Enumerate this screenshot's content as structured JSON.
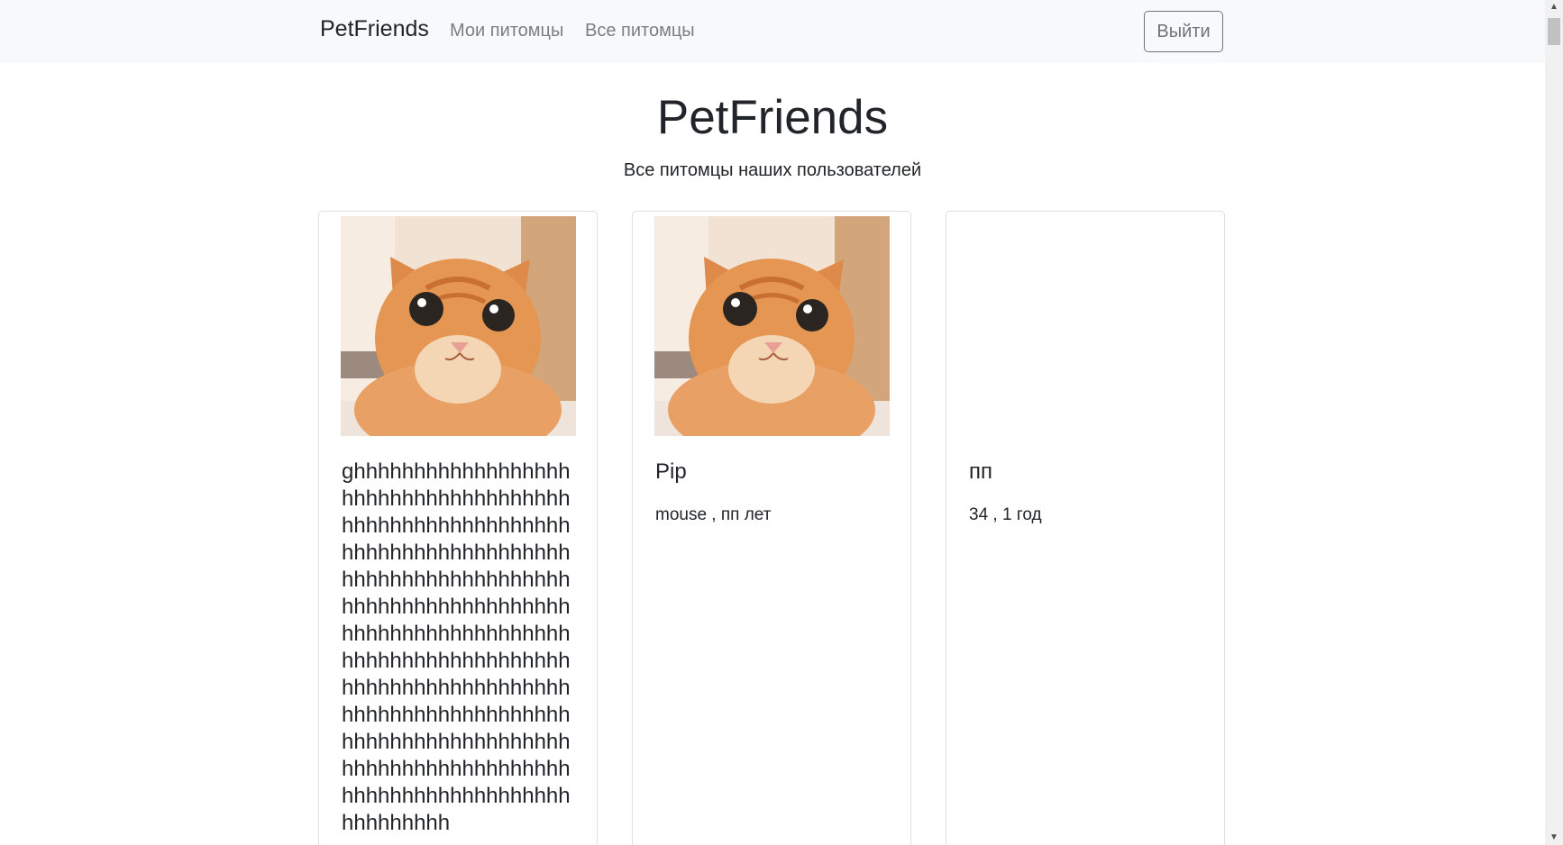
{
  "navbar": {
    "brand": "PetFriends",
    "links": [
      "Мои питомцы",
      "Все питомцы"
    ],
    "logout_label": "Выйти"
  },
  "hero": {
    "title": "PetFriends",
    "subtitle": "Все питомцы наших пользователей"
  },
  "cards": [
    {
      "name": "ghhhhhhhhhhhhhhhhhhhhhhhhhhhhhhhhhhhhhhhhhhhhhhhhhhhhhhhhhhhhhhhhhhhhhhhhhhhhhhhhhhhhhhhhhhhhhhhhhhhhhhhhhhhhhhhhhhhhhhhhhhhhhhhhhhhhhhhhhhhhhhhhhhhhhhhhhhhhhhhhhhhhhhhhhhhhhhhhhhhhhhhhhhhhhhhhhhhhhhhhhhhhhhhhhhhhhhhhhhhhhhhhhhhhhhhhhhhhhhhhhhhhhhhhhhhhhhh",
      "details": "",
      "has_photo": true
    },
    {
      "name": "Pip",
      "details": "mouse , пп лет",
      "has_photo": true
    },
    {
      "name": "пп",
      "details": "34 , 1 год",
      "has_photo": false
    }
  ],
  "colors": {
    "navbar_bg": "#f8f9fa",
    "nav_link": "#7b7f83",
    "button_outline": "#6c757d",
    "card_border": "#dfdfdf",
    "cat_fur": "#e08a4c"
  },
  "icons": {
    "scroll_up": "▲",
    "scroll_down": "▼"
  }
}
